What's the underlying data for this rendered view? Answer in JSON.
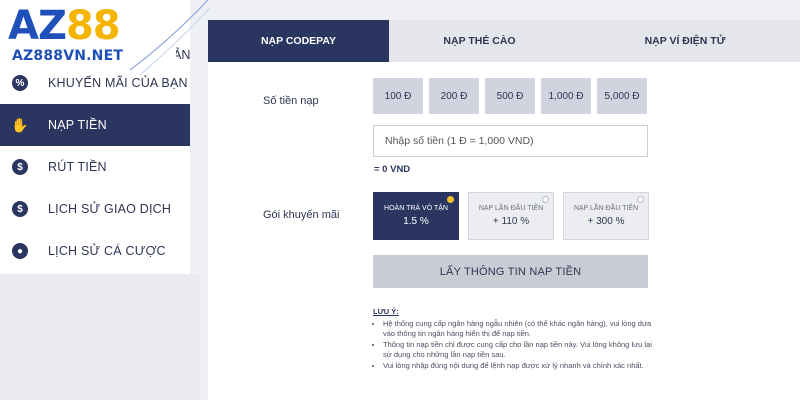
{
  "logo": {
    "brand_az": "AZ",
    "brand_88": "88",
    "url": "AZ888VN.NET"
  },
  "sidebar": {
    "items": [
      {
        "label": "TÀI KHOẢN",
        "icon": "user-icon"
      },
      {
        "label": "KHUYẾN MÃI CỦA BẠN",
        "icon": "gift-icon"
      },
      {
        "label": "NẠP TIỀN",
        "icon": "deposit-icon"
      },
      {
        "label": "RÚT TIỀN",
        "icon": "withdraw-icon"
      },
      {
        "label": "LỊCH SỬ GIAO DỊCH",
        "icon": "transaction-icon"
      },
      {
        "label": "LỊCH SỬ CÁ CƯỢC",
        "icon": "ball-icon"
      }
    ]
  },
  "tabs": [
    "NẠP CODEPAY",
    "NẠP THẺ CÀO",
    "NẠP VÍ ĐIỆN TỬ"
  ],
  "form": {
    "amount_label": "Số tiền nạp",
    "amount_options": [
      "100 Đ",
      "200 Đ",
      "500 Đ",
      "1,000 Đ",
      "5,000 Đ"
    ],
    "amount_placeholder": "Nhập số tiền (1 Đ = 1,000 VND)",
    "converted": "= 0 VND",
    "promo_label": "Gói khuyến mãi",
    "promos": [
      {
        "title": "HOÀN TRẢ VÔ TẬN",
        "value": "1.5 %"
      },
      {
        "title": "NẠP LẦN ĐẦU TIÊN",
        "value": "+ 110 %"
      },
      {
        "title": "NẠP LẦN ĐẦU TIÊN",
        "value": "+ 300 %"
      }
    ],
    "submit_label": "LẤY THÔNG TIN NẠP TIỀN"
  },
  "note": {
    "title": "LƯU Ý:",
    "items": [
      "Hệ thống cung cấp ngân hàng ngẫu nhiên (có thể khác ngân hàng), vui lòng dựa vào thông tin ngân hàng hiển thị để nạp tiền.",
      "Thông tin nạp tiền chỉ được cung cấp cho lần nạp tiền này. Vui lòng không lưu lại sử dụng cho những lần nạp tiền sau.",
      "Vui lòng nhập đúng nội dung để lệnh nạp được xử lý nhanh và chính xác nhất."
    ]
  },
  "colors": {
    "navy": "#2a3560",
    "accent": "#f2c230",
    "brand_blue": "#1f4fb8",
    "brand_gold": "#f4b400"
  }
}
